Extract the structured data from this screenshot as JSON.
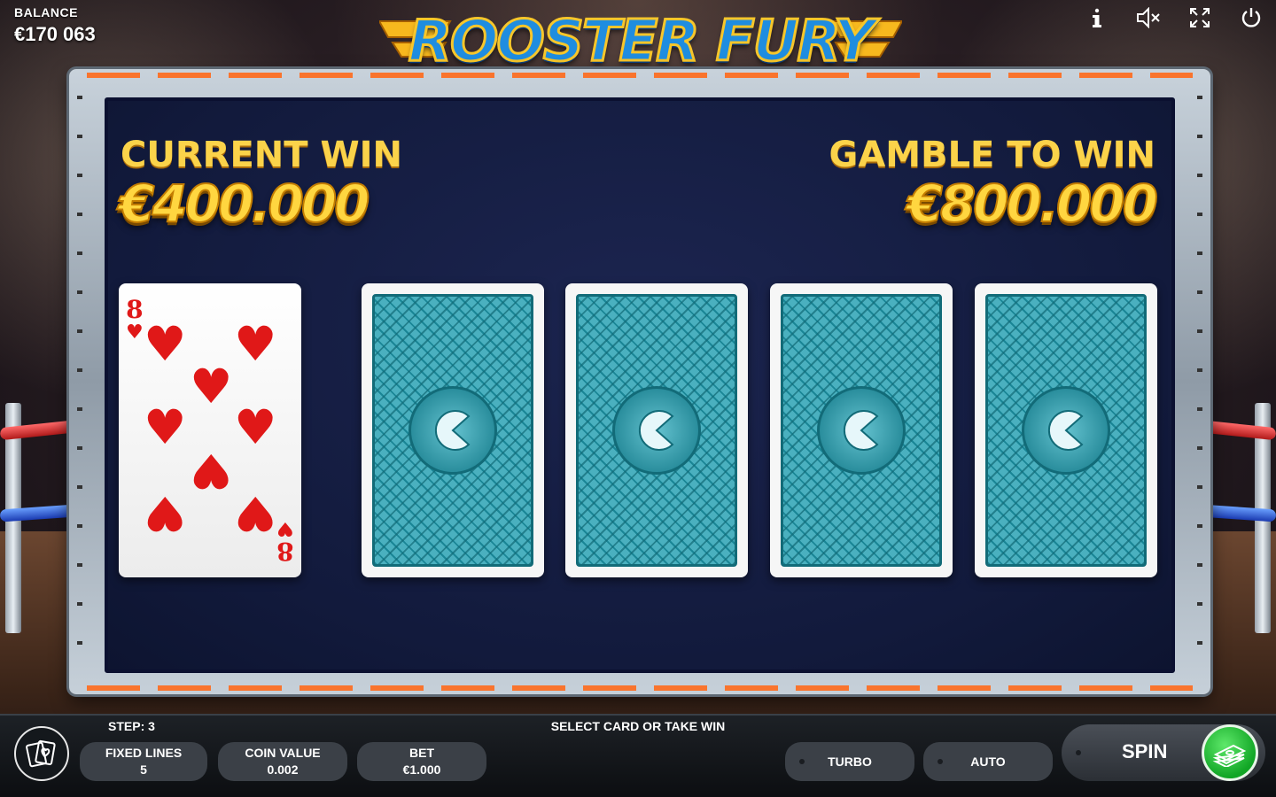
{
  "balance": {
    "label": "BALANCE",
    "value": "€170 063"
  },
  "logo": {
    "text": "ROOSTER FURY"
  },
  "top_icons": [
    "info-icon",
    "sound-muted-icon",
    "fullscreen-icon",
    "power-icon"
  ],
  "board": {
    "current_win": {
      "label": "CURRENT WIN",
      "amount": "€400.000"
    },
    "gamble_to_win": {
      "label": "GAMBLE TO WIN",
      "amount": "€800.000"
    },
    "dealer_card": {
      "rank": "8",
      "suit": "hearts",
      "suit_symbol": "♥",
      "color": "#e01818"
    },
    "face_down_cards": 4
  },
  "footer": {
    "step": "STEP: 3",
    "status": "SELECT CARD OR TAKE WIN",
    "fixed_lines": {
      "label": "FIXED LINES",
      "value": "5"
    },
    "coin_value": {
      "label": "COIN VALUE",
      "value": "0.002"
    },
    "bet": {
      "label": "BET",
      "value": "€1.000"
    },
    "turbo": "TURBO",
    "auto": "AUTO",
    "spin": "SPIN"
  },
  "colors": {
    "gold": "#fbd34a",
    "board_bg": "#121a3c",
    "card_back": "#3aa0ae",
    "spin_green": "#11a625"
  }
}
